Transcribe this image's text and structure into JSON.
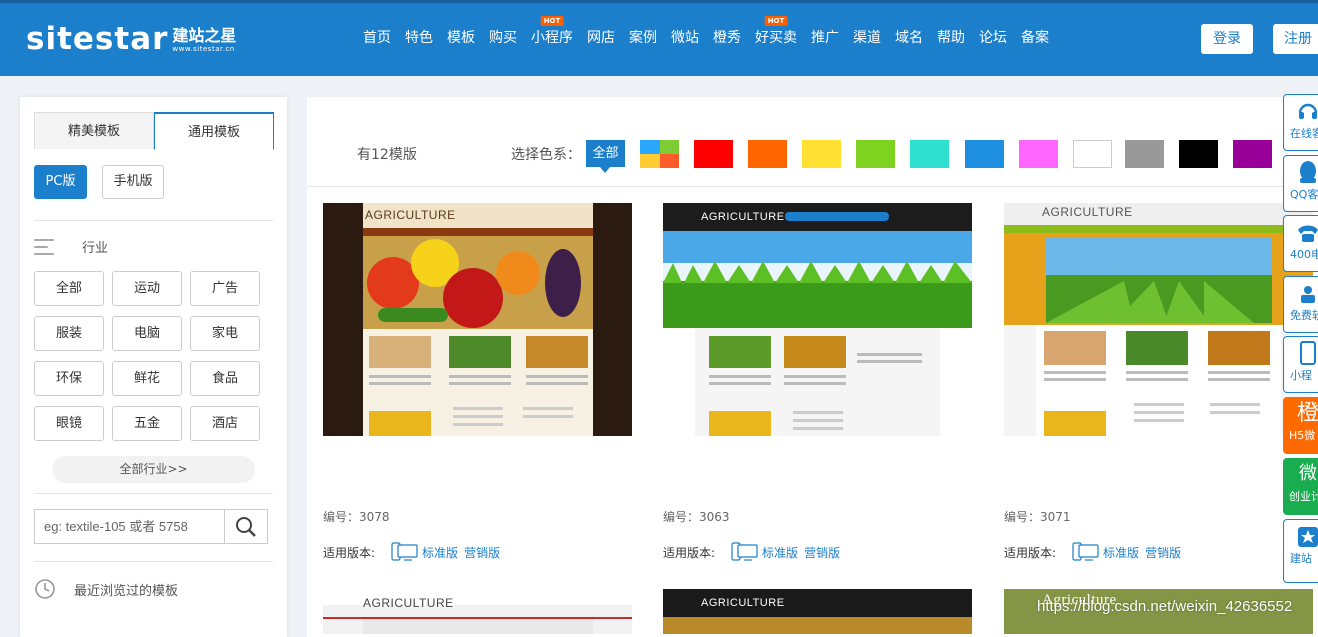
{
  "logo": {
    "word": "sitestar",
    "cn": "建站之星",
    "domain": "www.sitestar.cn"
  },
  "nav": [
    {
      "label": "首页",
      "hot": ""
    },
    {
      "label": "特色",
      "hot": ""
    },
    {
      "label": "模板",
      "hot": ""
    },
    {
      "label": "购买",
      "hot": ""
    },
    {
      "label": "小程序",
      "hot": "HOT"
    },
    {
      "label": "网店",
      "hot": ""
    },
    {
      "label": "案例",
      "hot": ""
    },
    {
      "label": "微站",
      "hot": ""
    },
    {
      "label": "橙秀",
      "hot": ""
    },
    {
      "label": "好买卖",
      "hot": "HOT"
    },
    {
      "label": "推广",
      "hot": ""
    },
    {
      "label": "渠道",
      "hot": ""
    },
    {
      "label": "域名",
      "hot": ""
    },
    {
      "label": "帮助",
      "hot": ""
    },
    {
      "label": "论坛",
      "hot": ""
    },
    {
      "label": "备案",
      "hot": ""
    }
  ],
  "auth": {
    "login": "登录",
    "register": "注册"
  },
  "sidebar": {
    "tabs": [
      "精美模板",
      "通用模板"
    ],
    "versions": [
      "PC版",
      "手机版"
    ],
    "industry_title": "行业",
    "categories": [
      "全部",
      "运动",
      "广告",
      "服装",
      "电脑",
      "家电",
      "环保",
      "鲜花",
      "食品",
      "眼镜",
      "五金",
      "酒店"
    ],
    "all_industry": "全部行业>>",
    "search_placeholder": "eg: textile-105 或者 5758",
    "recent": "最近浏览过的模板"
  },
  "filter": {
    "count_text": "有12模版",
    "color_label": "选择色系：",
    "all": "全部",
    "colors": [
      "#ff0000",
      "#ff6600",
      "#ffe033",
      "#7ed321",
      "#2ee0d0",
      "#1e8ee0",
      "#ff66ff",
      "#ffffff",
      "#999999",
      "#000000",
      "#990099"
    ]
  },
  "cards": [
    {
      "id_label": "编号：3078",
      "ver_label": "适用版本:",
      "std": "标准版",
      "mkt": "营销版",
      "thumb_title": "AGRICULTURE"
    },
    {
      "id_label": "编号：3063",
      "ver_label": "适用版本:",
      "std": "标准版",
      "mkt": "营销版",
      "thumb_title": "AGRICULTURE"
    },
    {
      "id_label": "编号：3071",
      "ver_label": "适用版本:",
      "std": "标准版",
      "mkt": "营销版",
      "thumb_title": "AGRICULTURE"
    }
  ],
  "row2_titles": [
    "AGRICULTURE",
    "AGRICULTURE",
    "Agriculture"
  ],
  "rightbar": [
    "在线客",
    "QQ客",
    "400电",
    "免费软",
    "小程",
    "H5微",
    "创业计",
    "建站"
  ],
  "watermark": "https://blog.csdn.net/weixin_42636552"
}
